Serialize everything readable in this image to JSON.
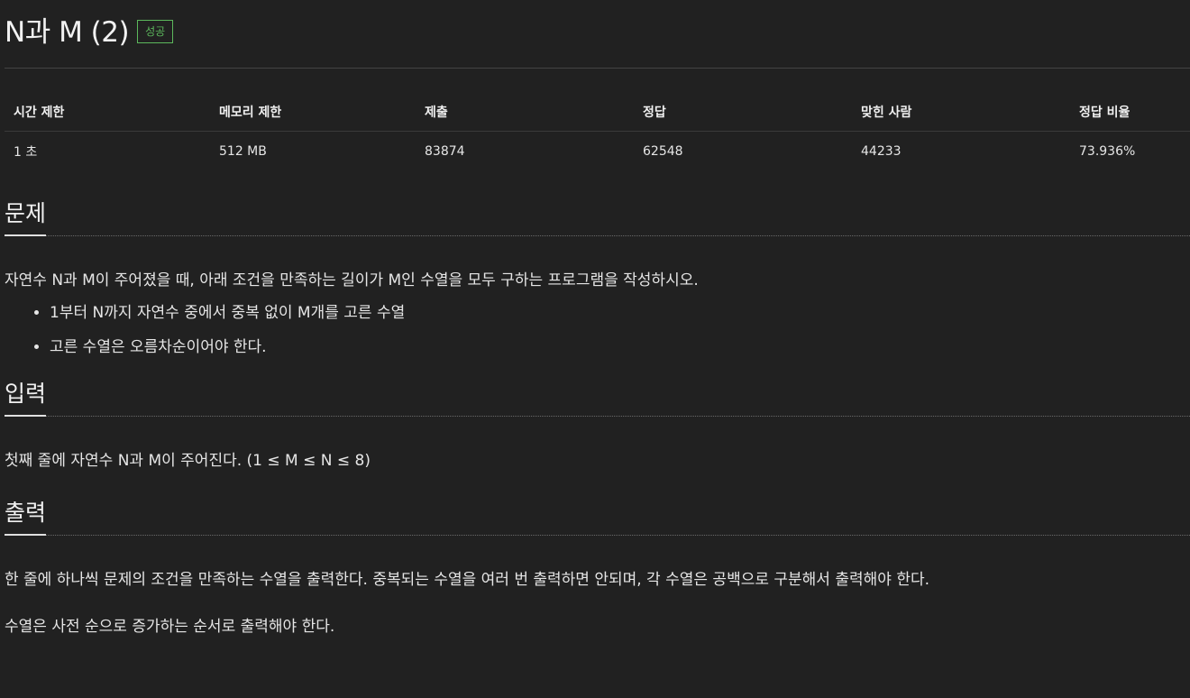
{
  "problem": {
    "title": "N과 M (2)",
    "status_badge": "성공"
  },
  "info_table": {
    "headers": [
      "시간 제한",
      "메모리 제한",
      "제출",
      "정답",
      "맞힌 사람",
      "정답 비율"
    ],
    "values": [
      "1 초",
      "512 MB",
      "83874",
      "62548",
      "44233",
      "73.936%"
    ]
  },
  "description": {
    "heading": "문제",
    "text": "자연수 N과 M이 주어졌을 때, 아래 조건을 만족하는 길이가 M인 수열을 모두 구하는 프로그램을 작성하시오.",
    "conditions": [
      "1부터 N까지 자연수 중에서 중복 없이 M개를 고른 수열",
      "고른 수열은 오름차순이어야 한다."
    ]
  },
  "input": {
    "heading": "입력",
    "text": "첫째 줄에 자연수 N과 M이 주어진다. (1 ≤ M ≤ N ≤ 8)"
  },
  "output": {
    "heading": "출력",
    "paragraphs": [
      "한 줄에 하나씩 문제의 조건을 만족하는 수열을 출력한다. 중복되는 수열을 여러 번 출력하면 안되며, 각 수열은 공백으로 구분해서 출력해야 한다.",
      "수열은 사전 순으로 증가하는 순서로 출력해야 한다."
    ]
  }
}
